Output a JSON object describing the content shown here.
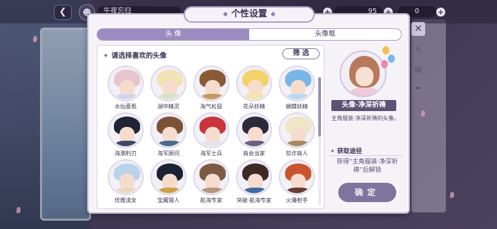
{
  "topbar": {
    "back_icon": "chevron-left-icon",
    "player_name": "午夜忘归",
    "currency_1": "95",
    "currency_2": "0"
  },
  "dialog": {
    "title": "个性设置",
    "tabs": [
      {
        "label": "头  像",
        "active": true
      },
      {
        "label": "头像框",
        "active": false
      }
    ],
    "panel": {
      "heading": "请选择喜欢的头像",
      "filter_label": "筛  选"
    },
    "avatars": [
      {
        "name": "水仙豪氪",
        "hair": "#e7c5cf",
        "body": "#cfd6ee"
      },
      {
        "name": "湖中精灵",
        "hair": "#f1e3b6",
        "body": "#d7e3c8"
      },
      {
        "name": "淘气松鼠",
        "hair": "#8a5a36",
        "body": "#c69a5c"
      },
      {
        "name": "花朵妖精",
        "hair": "#f2d26a",
        "body": "#f0e6a6"
      },
      {
        "name": "蝴蝶妖精",
        "hair": "#79b6e6",
        "body": "#b9d7f0"
      },
      {
        "name": "海潮利刃",
        "hair": "#1f2536",
        "body": "#3d4966"
      },
      {
        "name": "海军顾问",
        "hair": "#7b5237",
        "body": "#4a6b8c"
      },
      {
        "name": "海军士兵",
        "hair": "#c9363a",
        "body": "#e7e3ec"
      },
      {
        "name": "商会当家",
        "hair": "#2b2b3a",
        "body": "#6a5f80"
      },
      {
        "name": "狡诈商人",
        "hair": "#efe6c7",
        "body": "#a58a63"
      },
      {
        "name": "优雅淩女",
        "hair": "#b9d3ea",
        "body": "#e9d7c0"
      },
      {
        "name": "宝藏猎人",
        "hair": "#1d2232",
        "body": "#c9a34a"
      },
      {
        "name": "航海专家",
        "hair": "#7b5a45",
        "body": "#b89479"
      },
      {
        "name": "突破·航海专家",
        "hair": "#3c2a25",
        "body": "#3f6ba0"
      },
      {
        "name": "火爆射手",
        "hair": "#c9552e",
        "body": "#6a3a36"
      }
    ],
    "detail": {
      "item_title": "头像·净深祈祷",
      "description": "主角服装·净深祈祷的头像。",
      "source_heading": "获取途径",
      "source_text": "获得“主角服装·净深祈祷”后解锁",
      "confirm_label": "确定"
    }
  },
  "colors": {
    "accent": "#9a8cc0",
    "title_bar": "#5c5276",
    "confirm": "#7f749d"
  }
}
